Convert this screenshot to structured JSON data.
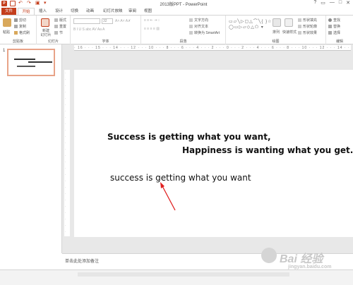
{
  "titlebar": {
    "title": "2013版PPT - PowerPoint",
    "controls": [
      "?",
      "▭",
      "—",
      "□",
      "✕"
    ]
  },
  "tabs": [
    {
      "label": "文件",
      "active": false
    },
    {
      "label": "开始",
      "active": true
    },
    {
      "label": "插入",
      "active": false
    },
    {
      "label": "设计",
      "active": false
    },
    {
      "label": "切换",
      "active": false
    },
    {
      "label": "动画",
      "active": false
    },
    {
      "label": "幻灯片放映",
      "active": false
    },
    {
      "label": "审阅",
      "active": false
    },
    {
      "label": "视图",
      "active": false
    }
  ],
  "ribbon": {
    "clipboard": {
      "paste": "粘贴",
      "cut": "剪切",
      "copy": "复制",
      "format_painter": "格式刷",
      "label": "剪贴板"
    },
    "slides": {
      "new_slide": "新建\n幻灯片",
      "layout": "版式",
      "reset": "重置",
      "section": "节",
      "label": "幻灯片"
    },
    "font": {
      "label": "字体",
      "size": "32"
    },
    "paragraph": {
      "text_direction": "文字方向",
      "align_text": "对齐文本",
      "smartart": "转换为 SmartArt",
      "label": "段落"
    },
    "drawing": {
      "arrange": "排列",
      "quick_styles": "快速样式",
      "shape_fill": "形状填充",
      "shape_outline": "形状轮廓",
      "shape_effects": "形状效果",
      "label": "绘图"
    },
    "editing": {
      "find": "查找",
      "replace": "替换",
      "select": "选择",
      "label": "编辑"
    }
  },
  "thumbnail": {
    "number": "1"
  },
  "ruler": {
    "horizontal": "· 16 · · · 15 · · · 14 · · · 12 · · · 10 · · · 8 · · · 6 · · · 4 · · · 2 · · · 0 · · · 2 · · · 4 · · · 6 · · · 8 · · · 10 · · · 12 · · · 14 · · · 16 ·"
  },
  "slide": {
    "line1": "Success is getting what you want,",
    "line2": "Happiness is wanting what you get.",
    "line3": "success is getting what you want"
  },
  "notes": {
    "placeholder": "单击此处添加备注"
  },
  "watermark": {
    "brand": "Bai 经验",
    "url": "jingyan.baidu.com"
  },
  "colors": {
    "accent": "#c43e1c",
    "arrow": "#e02020"
  }
}
